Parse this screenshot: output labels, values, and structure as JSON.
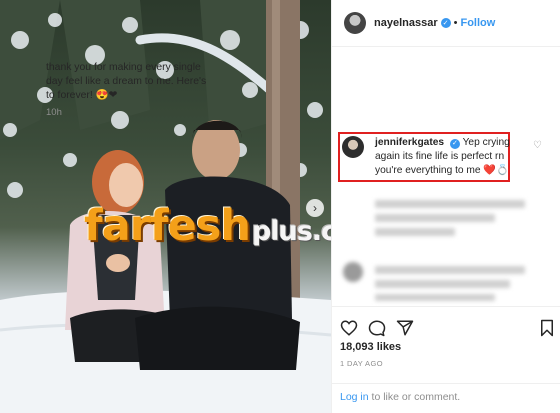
{
  "post": {
    "username": "nayelnassar",
    "verified_glyph": "✓",
    "separator": "•",
    "follow_label": "Follow",
    "caption": "thank you for making every single day feel like a dream to me. Here's to forever! 😍❤",
    "caption_time": "10h"
  },
  "comment": {
    "username": "jenniferkgates",
    "verified_glyph": "✓",
    "text": "Yep crying again its fine life is perfect rn you're everything to me ❤️💍"
  },
  "watermark": {
    "brand": "farfesh",
    "suffix": "plus.com"
  },
  "photo": {
    "next_glyph": "›"
  },
  "actions": {
    "likes": "18,093 likes",
    "time": "1 DAY AGO",
    "login_link": "Log in",
    "login_rest": " to like or comment."
  },
  "colors": {
    "accent": "#3897f0",
    "highlight_box": "#e02020",
    "watermark": "#f4a019"
  },
  "icons": [
    "heart-icon",
    "comment-icon",
    "share-icon",
    "bookmark-icon",
    "chevron-right-icon",
    "verified-icon"
  ]
}
